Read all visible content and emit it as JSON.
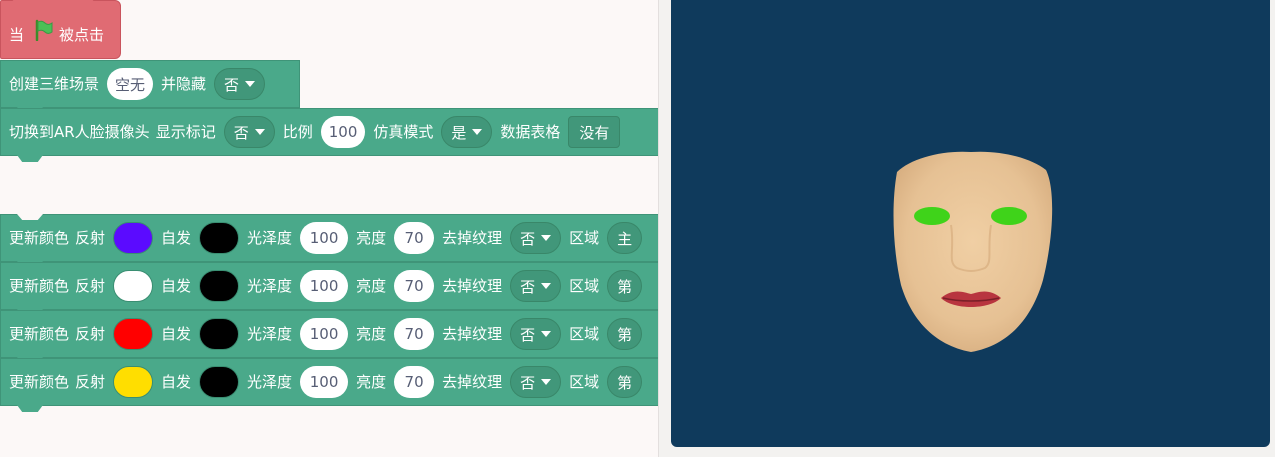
{
  "hat": {
    "prefix": "当",
    "suffix": "被点击",
    "flag_icon": "green-flag-icon",
    "color": "#e06b73"
  },
  "create_scene": {
    "label": "创建三维场景",
    "scene_value": "空无",
    "hide_label": "并隐藏",
    "hide_value": "否"
  },
  "ar_camera": {
    "label": "切换到AR人脸摄像头",
    "marker_label": "显示标记",
    "marker_value": "否",
    "scale_label": "比例",
    "scale_value": "100",
    "sim_label": "仿真模式",
    "sim_value": "是",
    "table_label": "数据表格",
    "table_value": "没有"
  },
  "update_blocks": [
    {
      "label": "更新颜色",
      "reflect_label": "反射",
      "reflect_color": "#5b0bff",
      "emit_label": "自发",
      "emit_color": "#000000",
      "gloss_label": "光泽度",
      "gloss_value": "100",
      "bright_label": "亮度",
      "bright_value": "70",
      "tex_label": "去掉纹理",
      "tex_value": "否",
      "region_label": "区域",
      "region_value": "主"
    },
    {
      "label": "更新颜色",
      "reflect_label": "反射",
      "reflect_color": "#ffffff",
      "emit_label": "自发",
      "emit_color": "#000000",
      "gloss_label": "光泽度",
      "gloss_value": "100",
      "bright_label": "亮度",
      "bright_value": "70",
      "tex_label": "去掉纹理",
      "tex_value": "否",
      "region_label": "区域",
      "region_value": "第"
    },
    {
      "label": "更新颜色",
      "reflect_label": "反射",
      "reflect_color": "#ff0000",
      "emit_label": "自发",
      "emit_color": "#000000",
      "gloss_label": "光泽度",
      "gloss_value": "100",
      "bright_label": "亮度",
      "bright_value": "70",
      "tex_label": "去掉纹理",
      "tex_value": "否",
      "region_label": "区域",
      "region_value": "第"
    },
    {
      "label": "更新颜色",
      "reflect_label": "反射",
      "reflect_color": "#ffde00",
      "emit_label": "自发",
      "emit_color": "#000000",
      "gloss_label": "光泽度",
      "gloss_value": "100",
      "bright_label": "亮度",
      "bright_value": "70",
      "tex_label": "去掉纹理",
      "tex_value": "否",
      "region_label": "区域",
      "region_value": "第"
    }
  ],
  "stage": {
    "background": "#0f3a5c",
    "face_color": "#e8c49a",
    "eye_color": "#3fd31a",
    "lip_color": "#b8353f"
  }
}
